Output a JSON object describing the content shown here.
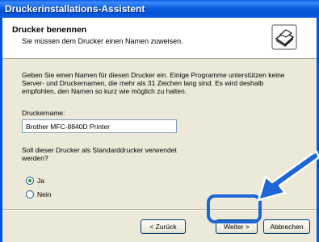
{
  "window": {
    "title": "Druckerinstallations-Assistent"
  },
  "header": {
    "title": "Drucker benennen",
    "subtitle": "Sie müssen dem Drucker einen Namen zuweisen."
  },
  "body": {
    "description": "Geben Sie einen Namen für diesen Drucker ein. Einige Programme unterstützen keine Server- und Druckernamen, die mehr als 31 Zeichen lang sind. Es wird deshalb empfohlen, den Namen so kurz wie möglich zu halten.",
    "printer_name_label": "Druckername:",
    "printer_name_value": "Brother MFC-8840D Printer",
    "default_question": "Soll dieser Drucker als Standarddrucker verwendet werden?",
    "options": [
      {
        "label": "Ja",
        "selected": true
      },
      {
        "label": "Nein",
        "selected": false
      }
    ]
  },
  "buttons": {
    "back": "< Zurück",
    "next": "Weiter >",
    "cancel": "Abbrechen"
  },
  "colors": {
    "titlebar": "#0054e3",
    "highlight": "#1e66d6",
    "dialog_bg": "#ece9d8"
  },
  "icons": {
    "header": "printer-icon",
    "annotation": "arrow-icon"
  }
}
